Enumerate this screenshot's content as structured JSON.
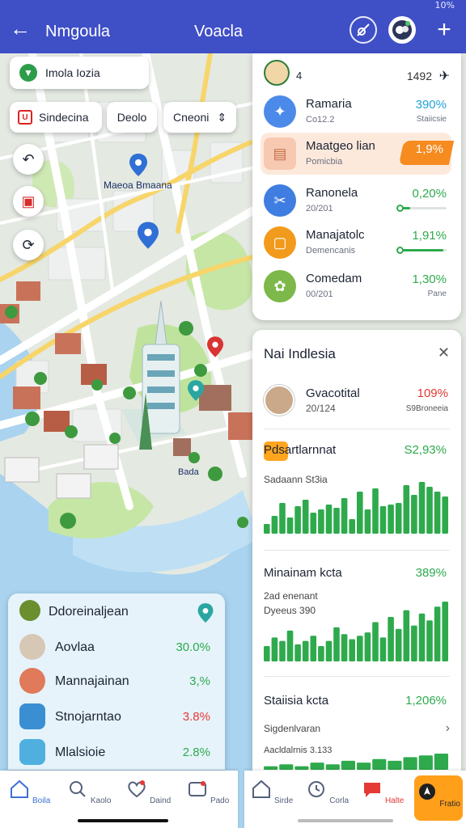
{
  "status_bar": {
    "battery": "10%"
  },
  "header": {
    "back_icon": "arrow-left-icon",
    "title": "Nmgoula",
    "center_title": "Voacla",
    "satellite_icon": "satellite-icon",
    "add_icon": "plus-icon"
  },
  "map": {
    "search_label": "Imola Iozia",
    "filters": [
      {
        "label": "Sindecina"
      },
      {
        "label": "Deolo"
      },
      {
        "label": "Cneoni"
      }
    ],
    "place_label": "Maeoa Bmaana",
    "small_label": "Bada"
  },
  "stats_card": {
    "left_number": "4",
    "right_number": "1492",
    "rows": [
      {
        "name": "Ramaria",
        "sub": "Co12.2",
        "value": "390%",
        "sub2": "Staiicsie",
        "color": "#4b8ae8",
        "value_color": "#22a3d8"
      },
      {
        "name": "Maatgeo lian",
        "sub": "Pomicbia",
        "value": "1,9%",
        "color": "#f7c9b1",
        "value_color": "#ffffff"
      },
      {
        "name": "Ranonela",
        "sub": "20/201",
        "value": "0,20%",
        "color": "#3f7de0",
        "value_color": "#2eaa4d",
        "progress": 0.2
      },
      {
        "name": "Manajatolc",
        "sub": "Demencanis",
        "value": "1,91%",
        "color": "#f29a1c",
        "value_color": "#2eaa4d",
        "progress": 0.92
      },
      {
        "name": "Comedam",
        "sub": "00/201",
        "value": "1,30%",
        "sub2": "Pane",
        "color": "#7db84a",
        "value_color": "#2eaa4d"
      }
    ]
  },
  "detail": {
    "title": "Nai Indlesia",
    "close_icon": "close-icon",
    "person": {
      "name": "Gvacotital",
      "sub": "20/124",
      "value": "109%",
      "sub2": "S9Broneeia"
    },
    "section1": {
      "title": "Pdsartlarnnat",
      "value": "S2,93%",
      "sub": "Sadaann St3ia",
      "bars": [
        12,
        22,
        38,
        20,
        34,
        42,
        26,
        30,
        36,
        32,
        44,
        18,
        52,
        30,
        56,
        34,
        36,
        38,
        60,
        48,
        64,
        58,
        52,
        46
      ]
    },
    "section2": {
      "title": "Minainam kcta",
      "value": "389%",
      "sub1": "2ad enenant",
      "sub2": "Dyeeus 390",
      "bars": [
        18,
        28,
        24,
        36,
        20,
        24,
        30,
        18,
        24,
        40,
        32,
        26,
        30,
        34,
        46,
        28,
        52,
        38,
        60,
        42,
        56,
        48,
        64,
        70
      ]
    },
    "section3": {
      "title": "Staiisia kcta",
      "value": "1,206%",
      "sub1": "Sigdenlvaran",
      "sub2": "Aacldalrnis 3.133",
      "bars": [
        4,
        6,
        4,
        8,
        6,
        10,
        8,
        12,
        10,
        14,
        16,
        18
      ]
    }
  },
  "legend": {
    "title": "Ddoreinaljean",
    "rows": [
      {
        "name": "Aovlaa",
        "value": "30.0%",
        "value_color": "#2eaa4d",
        "color": "#a06a3a"
      },
      {
        "name": "Mannajainan",
        "value": "3,%",
        "value_color": "#2eaa4d",
        "color": "#e05a5a"
      },
      {
        "name": "Stnojarntao",
        "value": "3.8%",
        "value_color": "#e53935",
        "color": "#3a8fd2"
      },
      {
        "name": "Mlalsioie",
        "value": "2.8%",
        "value_color": "#2eaa4d",
        "color": "#4fb0e0"
      }
    ]
  },
  "nav_left": [
    {
      "label": "Boila",
      "icon": "home-icon"
    },
    {
      "label": "Kaolo",
      "icon": "search-icon"
    },
    {
      "label": "Daind",
      "icon": "heart-icon"
    },
    {
      "label": "Pado",
      "icon": "message-icon"
    }
  ],
  "nav_right": [
    {
      "label": "Sirde",
      "icon": "home-icon"
    },
    {
      "label": "Corla",
      "icon": "clock-icon"
    },
    {
      "label": "Halte",
      "icon": "chat-icon"
    },
    {
      "label": "Fratio",
      "icon": "location-icon"
    }
  ]
}
